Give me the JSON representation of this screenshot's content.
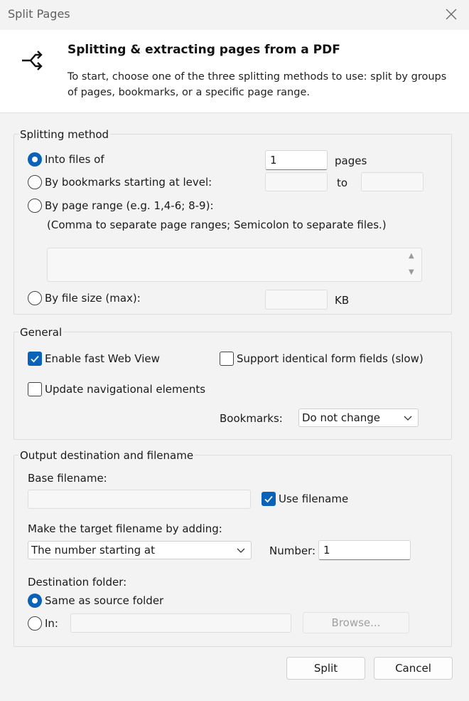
{
  "window": {
    "title": "Split Pages"
  },
  "header": {
    "title": "Splitting & extracting pages from a PDF",
    "description": "To start, choose one of the three splitting methods to use: split by groups of pages, bookmarks, or a specific page range."
  },
  "splitting_method": {
    "group_label": "Splitting method",
    "into_files_label": "Into files of",
    "into_files_value": "1",
    "into_files_unit": "pages",
    "bookmarks_label": "By bookmarks starting at level:",
    "bookmarks_to_label": "to",
    "page_range_label": "By page range (e.g. 1,4-6; 8-9):",
    "page_range_hint": "(Comma to separate page ranges; Semicolon to separate files.)",
    "file_size_label": "By file size (max):",
    "file_size_unit": "KB"
  },
  "general": {
    "group_label": "General",
    "fast_web_view_label": "Enable fast Web View",
    "identical_fields_label": "Support identical form fields (slow)",
    "update_nav_label": "Update navigational elements",
    "bookmarks_label": "Bookmarks:",
    "bookmarks_value": "Do not change"
  },
  "output": {
    "group_label": "Output destination and filename",
    "base_filename_label": "Base filename:",
    "use_filename_label": "Use filename",
    "make_target_label": "Make the target filename by adding:",
    "make_target_value": "The number starting at",
    "number_label": "Number:",
    "number_value": "1",
    "destination_label": "Destination folder:",
    "same_as_source_label": "Same as source folder",
    "in_label": "In:",
    "browse_label": "Browse..."
  },
  "buttons": {
    "split": "Split",
    "cancel": "Cancel"
  },
  "state": {
    "selected_method": "into_files",
    "fast_web_view": true,
    "identical_fields": false,
    "update_nav": false,
    "use_filename": true,
    "destination": "same_as_source"
  },
  "colors": {
    "accent": "#0a63b8",
    "background": "#f3f3f3"
  },
  "icons": [
    "close-icon",
    "split-icon",
    "chevron-down-icon",
    "check-icon",
    "spin-up-icon",
    "spin-down-icon"
  ]
}
